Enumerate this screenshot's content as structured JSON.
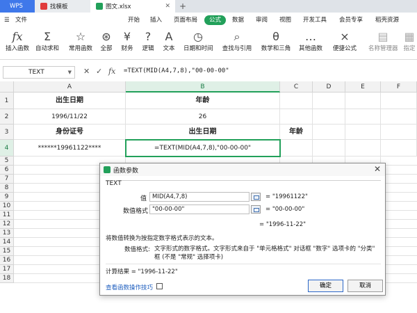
{
  "tabs": {
    "wps": "WPS",
    "template": "找模板",
    "file": "图文.xlsx",
    "new_tab": "+"
  },
  "menu": {
    "file": "文件",
    "items": [
      "开始",
      "插入",
      "页面布局",
      "公式",
      "数据",
      "审阅",
      "视图",
      "开发工具",
      "会员专享",
      "稻壳资源"
    ],
    "active": "公式"
  },
  "ribbon": {
    "buttons": [
      {
        "label": "插入函数",
        "icon": "fx"
      },
      {
        "label": "自动求和",
        "icon": "Σ"
      },
      {
        "label": "常用函数",
        "icon": "☆"
      },
      {
        "label": "全部",
        "icon": "⊛"
      },
      {
        "label": "财务",
        "icon": "¥"
      },
      {
        "label": "逻辑",
        "icon": "?"
      },
      {
        "label": "文本",
        "icon": "A"
      },
      {
        "label": "日期和时间",
        "icon": "◷"
      },
      {
        "label": "查找与引用",
        "icon": "⌕"
      },
      {
        "label": "数学和三角",
        "icon": "θ"
      },
      {
        "label": "其他函数",
        "icon": "…"
      },
      {
        "label": "便捷公式",
        "icon": "⨯"
      },
      {
        "label": "名称管理器",
        "icon": "▤"
      },
      {
        "label": "指定",
        "icon": "▦"
      }
    ]
  },
  "formula_bar": {
    "name_box": "TEXT",
    "formula": "=TEXT(MID(A4,7,8),\"00-00-00\""
  },
  "columns": [
    "A",
    "B",
    "C",
    "D",
    "E",
    "F"
  ],
  "rows": [
    "1",
    "2",
    "3",
    "4",
    "5",
    "6",
    "7",
    "8",
    "9",
    "10",
    "11",
    "12",
    "13",
    "14",
    "15",
    "16",
    "17",
    "18"
  ],
  "cells": {
    "A1": "出生日期",
    "B1": "年龄",
    "A2": "1996/11/22",
    "B2": "26",
    "A3": "身份证号",
    "B3": "出生日期",
    "C3": "年龄",
    "A4": "******19961122****",
    "B4": "=TEXT(MID(A4,7,8),\"00-00-00\""
  },
  "dialog": {
    "title": "函数参数",
    "function": "TEXT",
    "args": [
      {
        "label": "值",
        "value": "MID(A4,7,8)",
        "result": "= \"19961122\""
      },
      {
        "label": "数值格式",
        "value": "\"00-00-00\"",
        "result": "= \"00-00-00\""
      }
    ],
    "overall_result": "= \"1996-11-22\"",
    "description": "将数值转换为按指定数字格式表示的文本。",
    "arg_help_label": "数值格式:",
    "arg_help": "文字形式的数字格式。文字形式来自于 \"单元格格式\" 对话框 \"数字\" 选项卡的 \"分类\" 框 (不是 \"常规\" 选择项卡)",
    "calc_result": "计算结果 = \"1996-11-22\"",
    "help_link": "查看函数操作技巧",
    "ok": "确定",
    "cancel": "取消"
  },
  "colors": {
    "accent": "#22a05a",
    "wps_tab": "#3f78ea",
    "link": "#1f5fbf"
  }
}
